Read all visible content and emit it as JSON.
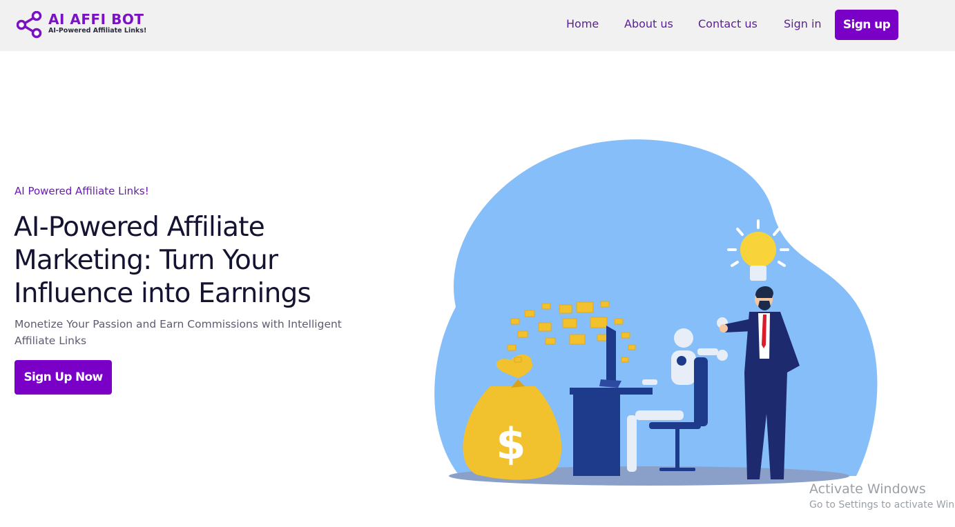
{
  "brand": {
    "name": "AI AFFI BOT",
    "tagline": "AI-Powered Affiliate Links!",
    "color": "#7a00c8"
  },
  "nav": {
    "items": [
      {
        "label": "Home"
      },
      {
        "label": "About us"
      },
      {
        "label": "Contact us"
      },
      {
        "label": "Sign in"
      }
    ],
    "signup_label": "Sign up"
  },
  "hero": {
    "eyebrow": "AI Powered Affiliate Links!",
    "headline": "AI-Powered Affiliate Marketing: Turn Your Influence into Earnings",
    "subtext": "Monetize Your Passion and Earn Commissions with Intelligent Affiliate Links",
    "cta_label": "Sign Up Now"
  },
  "overlay": {
    "activate_title": "Activate Windows",
    "activate_sub": "Go to Settings to activate Windows."
  }
}
